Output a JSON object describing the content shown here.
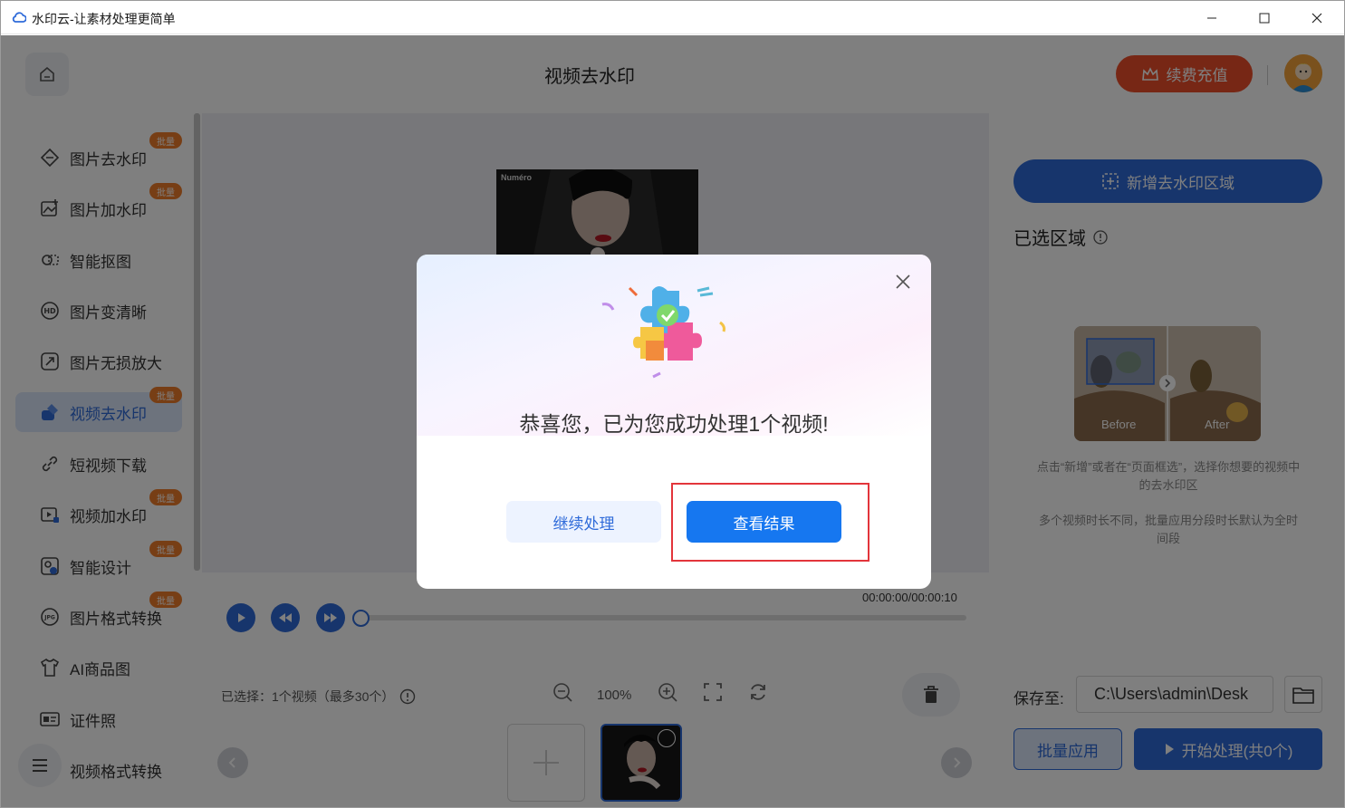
{
  "window": {
    "title": "水印云-让素材处理更简单"
  },
  "header": {
    "title": "视频去水印",
    "vip_label": "续费充值"
  },
  "sidebar": {
    "items": [
      {
        "label": "图片去水印",
        "badge": "批量"
      },
      {
        "label": "图片加水印",
        "badge": "批量"
      },
      {
        "label": "智能抠图",
        "badge": ""
      },
      {
        "label": "图片变清晰",
        "badge": ""
      },
      {
        "label": "图片无损放大",
        "badge": ""
      },
      {
        "label": "视频去水印",
        "badge": "批量"
      },
      {
        "label": "短视频下载",
        "badge": ""
      },
      {
        "label": "视频加水印",
        "badge": "批量"
      },
      {
        "label": "智能设计",
        "badge": "批量"
      },
      {
        "label": "图片格式转换",
        "badge": "批量"
      },
      {
        "label": "AI商品图",
        "badge": ""
      },
      {
        "label": "证件照",
        "badge": ""
      },
      {
        "label": "视频格式转换",
        "badge": ""
      }
    ]
  },
  "player": {
    "video_watermark": "Numéro",
    "timecode": "00:00:00/00:00:10",
    "selection_info": "已选择：1个视频（最多30个）",
    "zoom": "100%"
  },
  "right": {
    "add_region_label": "新增去水印区域",
    "selected_title": "已选区域",
    "before_label": "Before",
    "after_label": "After",
    "hint1": "点击“新增”或者在“页面框选”，选择你想要的视频中的去水印区",
    "hint2": "多个视频时长不同，批量应用分段时长默认为全时间段",
    "save_label": "保存至:",
    "save_path": "C:\\Users\\admin\\Desk",
    "batch_label": "批量应用",
    "start_label": "开始处理(共0个)"
  },
  "modal": {
    "message": "恭喜您，已为您成功处理1个视频!",
    "continue_label": "继续处理",
    "view_label": "查看结果"
  },
  "colors": {
    "accent": "#2f6bd9",
    "vip": "#ee4e2b",
    "badge": "#ef7d2a",
    "highlight": "#e3353b"
  }
}
